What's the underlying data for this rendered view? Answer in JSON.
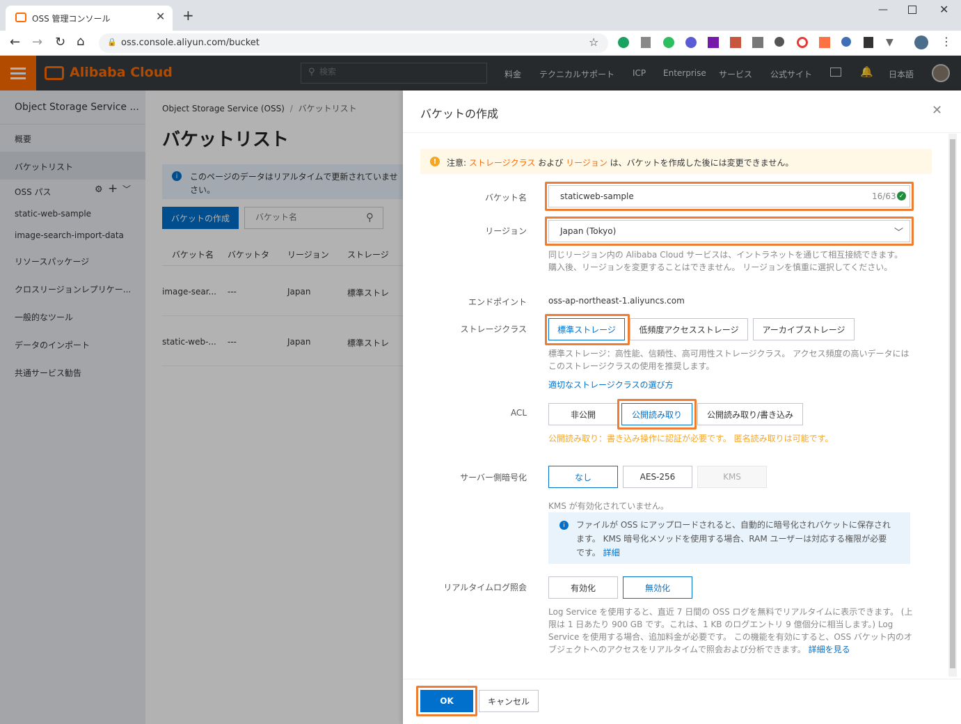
{
  "browser": {
    "tab_title": "OSS 管理コンソール",
    "url": "oss.console.aliyun.com/bucket"
  },
  "header": {
    "logo": "Alibaba Cloud",
    "search_placeholder": "検索",
    "nav": [
      "料金",
      "テクニカルサポート",
      "ICP",
      "Enterprise",
      "サービス",
      "公式サイト"
    ],
    "language": "日本語"
  },
  "sidebar": {
    "title": "Object Storage Service ...",
    "items": [
      "概要",
      "バケットリスト"
    ],
    "oss_path_label": "OSS パス",
    "paths": [
      "static-web-sample",
      "image-search-import-data"
    ],
    "more_items": [
      "リソースパッケージ",
      "クロスリージョンレプリケー...",
      "一般的なツール",
      "データのインポート",
      "共通サービス勧告"
    ]
  },
  "main": {
    "breadcrumb_root": "Object Storage Service (OSS)",
    "breadcrumb_sep": "/",
    "breadcrumb_current": "バケットリスト",
    "title": "バケットリスト",
    "notice_line1": "このページのデータはリアルタイムで更新されていませ",
    "notice_line2": "さい。",
    "create_button": "バケットの作成",
    "search_placeholder": "バケット名",
    "columns": [
      "バケット名",
      "バケットタ",
      "リージョン",
      "ストレージ"
    ],
    "rows": [
      [
        "image-sear...",
        "---",
        "Japan",
        "標準ストレ"
      ],
      [
        "static-web-...",
        "---",
        "Japan",
        "標準ストレ"
      ]
    ]
  },
  "panel": {
    "title": "バケットの作成",
    "warning_prefix": "注意:",
    "warning_storage": "ストレージクラス",
    "warning_and": "および",
    "warning_region": "リージョン",
    "warning_suffix": "は、バケットを作成した後には変更できません。",
    "bucket_name_label": "バケット名",
    "bucket_name_value": "staticweb-sample",
    "bucket_name_count": "16/63",
    "region_label": "リージョン",
    "region_value": "Japan (Tokyo)",
    "region_help_1": "同じリージョン内の Alibaba Cloud サービスは、イントラネットを通じて相互接続できます。",
    "region_help_2": "購入後、リージョンを変更することはできません。 リージョンを慎重に選択してください。",
    "endpoint_label": "エンドポイント",
    "endpoint_value": "oss-ap-northeast-1.aliyuncs.com",
    "storage_label": "ストレージクラス",
    "storage_options": [
      "標準ストレージ",
      "低頻度アクセスストレージ",
      "アーカイブストレージ"
    ],
    "storage_help_1": "標準ストレージ：高性能、信頼性、高可用性ストレージクラス。 アクセス頻度の高いデータには",
    "storage_help_2": "このストレージクラスの使用を推奨します。",
    "storage_link": "適切なストレージクラスの選び方",
    "acl_label": "ACL",
    "acl_options": [
      "非公開",
      "公開読み取り",
      "公開読み取り/書き込み"
    ],
    "acl_warning": "公開読み取り：書き込み操作に認証が必要です。 匿名読み取りは可能です。",
    "encrypt_label": "サーバー側暗号化",
    "encrypt_options": [
      "なし",
      "AES-256",
      "KMS"
    ],
    "kms_note": "KMS が有効化されていません。",
    "kms_info_1": "ファイルが OSS にアップロードされると、自動的に暗号化されバケットに保存され",
    "kms_info_2": "ます。 KMS 暗号化メソッドを使用する場合、RAM ユーザーは対応する権限が必要",
    "kms_info_3": "です。",
    "kms_info_link": "詳細",
    "log_label": "リアルタイムログ照会",
    "log_options": [
      "有効化",
      "無効化"
    ],
    "log_help_1": "Log Service を使用すると、直近 7 日間の OSS ログを無料でリアルタイムに表示できます。 (上",
    "log_help_2": "限は 1 日あたり 900 GB です。これは、1 KB のログエントリ 9 億個分に相当します。) Log",
    "log_help_3": "Service を使用する場合、追加料金が必要です。 この機能を有効にすると、OSS バケット内のオ",
    "log_help_4": "ブジェクトへのアクセスをリアルタイムで照会および分析できます。",
    "log_help_link": "詳細を見る",
    "ok": "OK",
    "cancel": "キャンセル"
  },
  "colors": {
    "accent": "#0070cc",
    "highlight": "#ed7d31",
    "brand": "#ff6a00",
    "warning": "#f5a623"
  }
}
